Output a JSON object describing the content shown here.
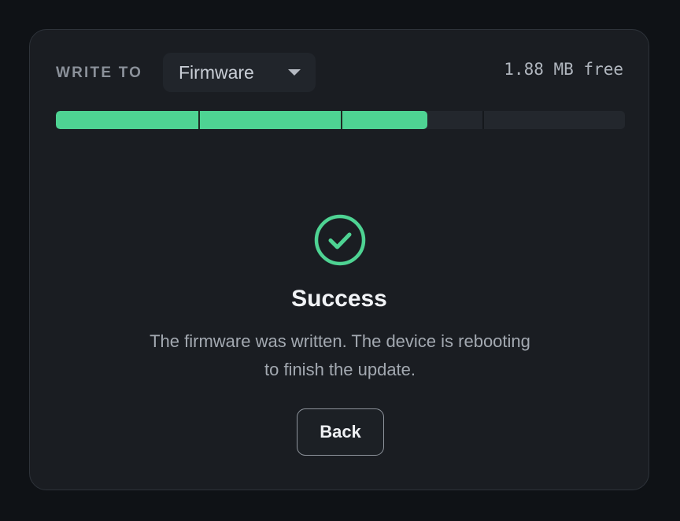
{
  "header": {
    "write_label": "WRITE TO",
    "target_select": {
      "value": "Firmware"
    },
    "free_space": "1.88 MB free"
  },
  "progress": {
    "fraction": 0.653,
    "segments": 4,
    "fill_color": "#4ed393"
  },
  "result": {
    "icon": "check-circle-icon",
    "icon_color": "#4ed393",
    "title": "Success",
    "message": "The firmware was written. The device is rebooting to finish the update."
  },
  "actions": {
    "back_label": "Back"
  }
}
